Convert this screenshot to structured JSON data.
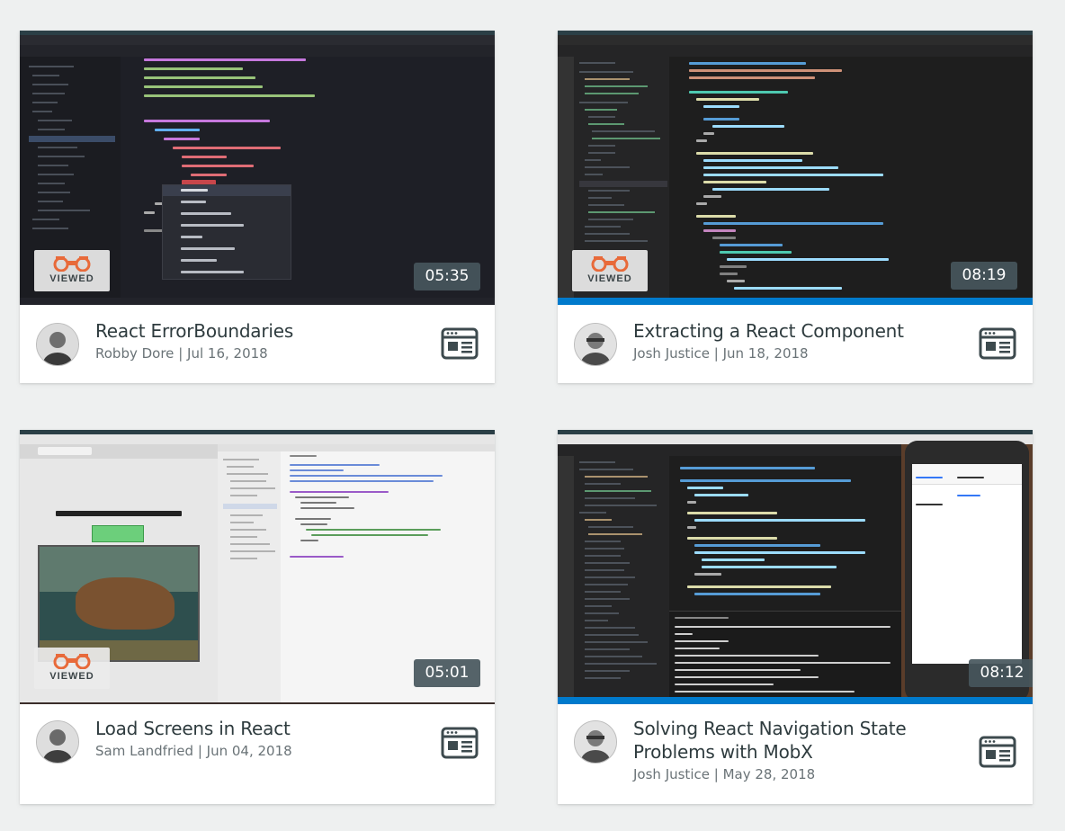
{
  "icons": {
    "viewed": "binoculars-icon",
    "content_type": "screencast-window-icon"
  },
  "colors": {
    "viewed_accent": "#e86a3a",
    "duration_bg": "#46565c",
    "title_text": "#2e3b3e",
    "meta_text": "#6a7377"
  },
  "cards": [
    {
      "title": "React ErrorBoundaries",
      "author": "Robby Dore",
      "separator": "|",
      "date": "Jul 16, 2018",
      "duration": "05:35",
      "viewed_label": "VIEWED"
    },
    {
      "title": "Extracting a React Component",
      "author": "Josh Justice",
      "separator": "|",
      "date": "Jun 18, 2018",
      "duration": "08:19",
      "viewed_label": "VIEWED"
    },
    {
      "title": "Load Screens in React",
      "author": "Sam Landfried",
      "separator": "|",
      "date": "Jun 04, 2018",
      "duration": "05:01",
      "viewed_label": "VIEWED"
    },
    {
      "title": "Solving React Navigation State Problems with MobX",
      "author": "Josh Justice",
      "separator": "|",
      "date": "May 28, 2018",
      "duration": "08:12"
    }
  ]
}
